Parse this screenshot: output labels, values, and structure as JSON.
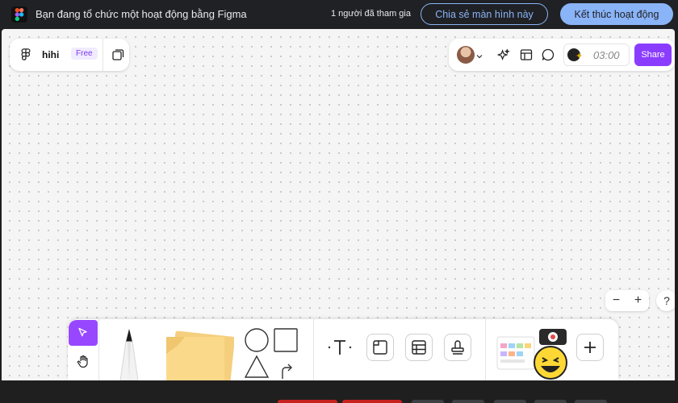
{
  "banner": {
    "title": "Bạn đang tổ chức một hoạt động bằng Figma",
    "participants": "1 người đã tham gia",
    "share_screen_label": "Chia sẻ màn hình này",
    "end_activity_label": "Kết thúc hoạt động"
  },
  "file": {
    "name": "hihi",
    "plan_badge": "Free"
  },
  "right_panel": {
    "timer": "03:00",
    "share_label": "Share"
  },
  "zoom": {
    "minus": "−",
    "plus": "+",
    "help": "?"
  },
  "toolbar": {
    "text_tool_glyph": "T",
    "tools": [
      "select",
      "hand",
      "marker",
      "sticky-note",
      "shapes",
      "text",
      "section",
      "table",
      "stamp",
      "widgets",
      "more"
    ]
  },
  "colors": {
    "banner_bg": "#202124",
    "accent_blue": "#8ab4f8",
    "figma_purple": "#8b3dff",
    "select_purple": "#9747ff",
    "sticky_yellow": "#fbd98a"
  }
}
